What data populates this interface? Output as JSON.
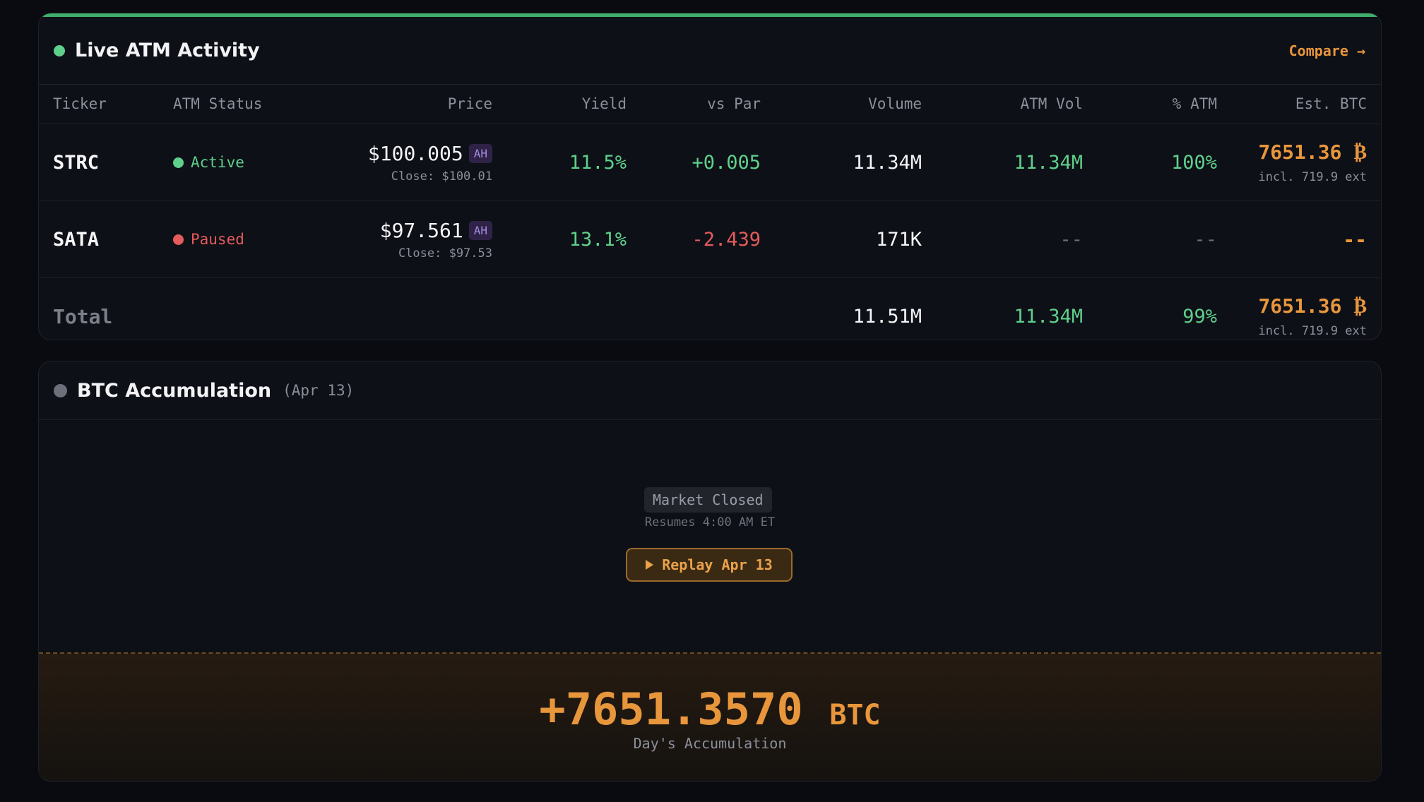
{
  "atm": {
    "title": "Live ATM Activity",
    "compare_label": "Compare →",
    "columns": [
      "Ticker",
      "ATM Status",
      "Price",
      "Yield",
      "vs Par",
      "Volume",
      "ATM Vol",
      "% ATM",
      "Est. BTC"
    ],
    "rows": [
      {
        "ticker": "STRC",
        "status": "Active",
        "price": "$100.005",
        "ah": "AH",
        "close": "Close: $100.01",
        "yield": "11.5%",
        "vs_par": "+0.005",
        "volume": "11.34M",
        "atm_vol": "11.34M",
        "pct_atm": "100%",
        "est_btc": "7651.36 ₿",
        "est_btc_sub": "incl. 719.9 ext"
      },
      {
        "ticker": "SATA",
        "status": "Paused",
        "price": "$97.561",
        "ah": "AH",
        "close": "Close: $97.53",
        "yield": "13.1%",
        "vs_par": "-2.439",
        "volume": "171K",
        "atm_vol": "--",
        "pct_atm": "--",
        "est_btc": "--"
      }
    ],
    "total": {
      "label": "Total",
      "volume": "11.51M",
      "atm_vol": "11.34M",
      "pct_atm": "99%",
      "est_btc": "7651.36 ₿",
      "est_btc_sub": "incl. 719.9 ext"
    }
  },
  "btc": {
    "title": "BTC Accumulation",
    "date": "(Apr 13)",
    "market_status": "Market Closed",
    "resumes": "Resumes 4:00 AM ET",
    "replay_label": "Replay Apr 13",
    "accumulation": "+7651.3570",
    "unit": "BTC",
    "accumulation_label": "Day's Accumulation"
  },
  "colors": {
    "green": "#5fd08c",
    "red": "#e45b5b",
    "orange": "#e8963c",
    "purple": "#a58be0",
    "grey_dot": "#6d707b"
  },
  "icons": [
    "status-dot-icon",
    "play-icon",
    "arrow-right-icon"
  ]
}
